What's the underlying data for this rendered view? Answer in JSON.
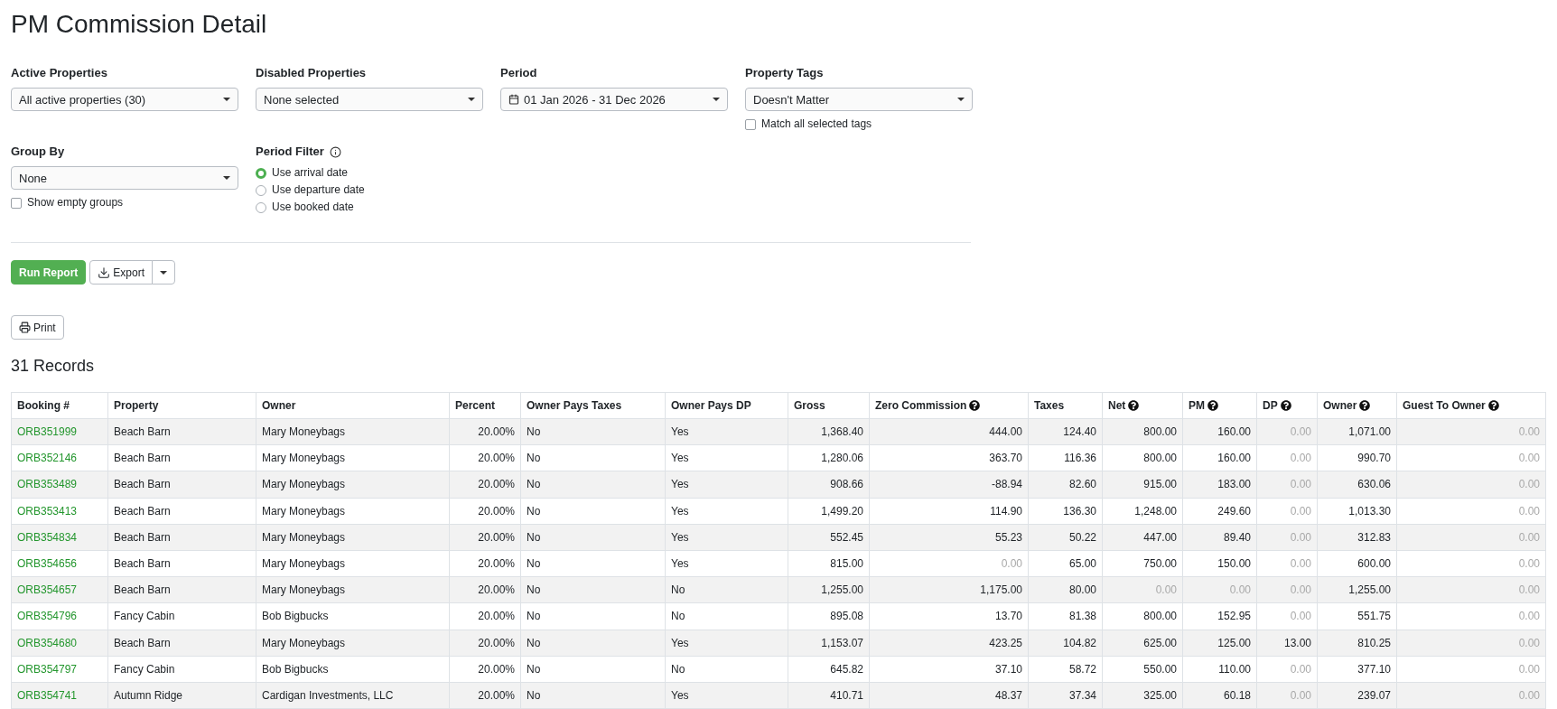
{
  "page": {
    "title": "PM Commission Detail"
  },
  "filters": [
    {
      "kind": "select",
      "label": "Active Properties",
      "value": "All active properties (30)"
    },
    {
      "kind": "select",
      "label": "Disabled Properties",
      "value": "None selected"
    },
    {
      "kind": "date_range",
      "label": "Period",
      "value": "01 Jan 2026 - 31 Dec 2026"
    },
    {
      "kind": "select",
      "label": "Property Tags",
      "value": "Doesn't Matter",
      "checkbox": {
        "label": "Match all selected tags",
        "checked": false
      }
    },
    {
      "kind": "select",
      "label": "Group By",
      "value": "None",
      "checkbox": {
        "label": "Show empty groups",
        "checked": false
      }
    },
    {
      "kind": "radio_group",
      "label": "Period Filter",
      "info_icon": true,
      "options": [
        {
          "label": "Use arrival date",
          "selected": true
        },
        {
          "label": "Use departure date",
          "selected": false
        },
        {
          "label": "Use booked date",
          "selected": false
        }
      ]
    }
  ],
  "actions": {
    "run": "Run Report",
    "export": "Export",
    "print": "Print"
  },
  "records_count": "31 Records",
  "table": {
    "columns": [
      {
        "label": "Booking #",
        "help": false
      },
      {
        "label": "Property",
        "help": false
      },
      {
        "label": "Owner",
        "help": false
      },
      {
        "label": "Percent",
        "help": false
      },
      {
        "label": "Owner Pays Taxes",
        "help": false
      },
      {
        "label": "Owner Pays DP",
        "help": false
      },
      {
        "label": "Gross",
        "help": false
      },
      {
        "label": "Zero Commission",
        "help": true
      },
      {
        "label": "Taxes",
        "help": false
      },
      {
        "label": "Net",
        "help": true
      },
      {
        "label": "PM",
        "help": true
      },
      {
        "label": "DP",
        "help": true
      },
      {
        "label": "Owner",
        "help": true
      },
      {
        "label": "Guest To Owner",
        "help": true
      }
    ],
    "rows": [
      {
        "booking": "ORB351999",
        "property": "Beach Barn",
        "owner": "Mary Moneybags",
        "percent": "20.00%",
        "owner_pays_taxes": "No",
        "owner_pays_dp": "Yes",
        "amounts": [
          {
            "text": "1,368.40",
            "muted": false
          },
          {
            "text": "444.00",
            "muted": false
          },
          {
            "text": "124.40",
            "muted": false
          },
          {
            "text": "800.00",
            "muted": false
          },
          {
            "text": "160.00",
            "muted": false
          },
          {
            "text": "0.00",
            "muted": true
          },
          {
            "text": "1,071.00",
            "muted": false
          },
          {
            "text": "0.00",
            "muted": true
          }
        ]
      },
      {
        "booking": "ORB352146",
        "property": "Beach Barn",
        "owner": "Mary Moneybags",
        "percent": "20.00%",
        "owner_pays_taxes": "No",
        "owner_pays_dp": "Yes",
        "amounts": [
          {
            "text": "1,280.06",
            "muted": false
          },
          {
            "text": "363.70",
            "muted": false
          },
          {
            "text": "116.36",
            "muted": false
          },
          {
            "text": "800.00",
            "muted": false
          },
          {
            "text": "160.00",
            "muted": false
          },
          {
            "text": "0.00",
            "muted": true
          },
          {
            "text": "990.70",
            "muted": false
          },
          {
            "text": "0.00",
            "muted": true
          }
        ]
      },
      {
        "booking": "ORB353489",
        "property": "Beach Barn",
        "owner": "Mary Moneybags",
        "percent": "20.00%",
        "owner_pays_taxes": "No",
        "owner_pays_dp": "Yes",
        "amounts": [
          {
            "text": "908.66",
            "muted": false
          },
          {
            "text": "-88.94",
            "muted": false
          },
          {
            "text": "82.60",
            "muted": false
          },
          {
            "text": "915.00",
            "muted": false
          },
          {
            "text": "183.00",
            "muted": false
          },
          {
            "text": "0.00",
            "muted": true
          },
          {
            "text": "630.06",
            "muted": false
          },
          {
            "text": "0.00",
            "muted": true
          }
        ]
      },
      {
        "booking": "ORB353413",
        "property": "Beach Barn",
        "owner": "Mary Moneybags",
        "percent": "20.00%",
        "owner_pays_taxes": "No",
        "owner_pays_dp": "Yes",
        "amounts": [
          {
            "text": "1,499.20",
            "muted": false
          },
          {
            "text": "114.90",
            "muted": false
          },
          {
            "text": "136.30",
            "muted": false
          },
          {
            "text": "1,248.00",
            "muted": false
          },
          {
            "text": "249.60",
            "muted": false
          },
          {
            "text": "0.00",
            "muted": true
          },
          {
            "text": "1,013.30",
            "muted": false
          },
          {
            "text": "0.00",
            "muted": true
          }
        ]
      },
      {
        "booking": "ORB354834",
        "property": "Beach Barn",
        "owner": "Mary Moneybags",
        "percent": "20.00%",
        "owner_pays_taxes": "No",
        "owner_pays_dp": "Yes",
        "amounts": [
          {
            "text": "552.45",
            "muted": false
          },
          {
            "text": "55.23",
            "muted": false
          },
          {
            "text": "50.22",
            "muted": false
          },
          {
            "text": "447.00",
            "muted": false
          },
          {
            "text": "89.40",
            "muted": false
          },
          {
            "text": "0.00",
            "muted": true
          },
          {
            "text": "312.83",
            "muted": false
          },
          {
            "text": "0.00",
            "muted": true
          }
        ]
      },
      {
        "booking": "ORB354656",
        "property": "Beach Barn",
        "owner": "Mary Moneybags",
        "percent": "20.00%",
        "owner_pays_taxes": "No",
        "owner_pays_dp": "Yes",
        "amounts": [
          {
            "text": "815.00",
            "muted": false
          },
          {
            "text": "0.00",
            "muted": true
          },
          {
            "text": "65.00",
            "muted": false
          },
          {
            "text": "750.00",
            "muted": false
          },
          {
            "text": "150.00",
            "muted": false
          },
          {
            "text": "0.00",
            "muted": true
          },
          {
            "text": "600.00",
            "muted": false
          },
          {
            "text": "0.00",
            "muted": true
          }
        ]
      },
      {
        "booking": "ORB354657",
        "property": "Beach Barn",
        "owner": "Mary Moneybags",
        "percent": "20.00%",
        "owner_pays_taxes": "No",
        "owner_pays_dp": "No",
        "amounts": [
          {
            "text": "1,255.00",
            "muted": false
          },
          {
            "text": "1,175.00",
            "muted": false
          },
          {
            "text": "80.00",
            "muted": false
          },
          {
            "text": "0.00",
            "muted": true
          },
          {
            "text": "0.00",
            "muted": true
          },
          {
            "text": "0.00",
            "muted": true
          },
          {
            "text": "1,255.00",
            "muted": false
          },
          {
            "text": "0.00",
            "muted": true
          }
        ]
      },
      {
        "booking": "ORB354796",
        "property": "Fancy Cabin",
        "owner": "Bob Bigbucks",
        "percent": "20.00%",
        "owner_pays_taxes": "No",
        "owner_pays_dp": "No",
        "amounts": [
          {
            "text": "895.08",
            "muted": false
          },
          {
            "text": "13.70",
            "muted": false
          },
          {
            "text": "81.38",
            "muted": false
          },
          {
            "text": "800.00",
            "muted": false
          },
          {
            "text": "152.95",
            "muted": false
          },
          {
            "text": "0.00",
            "muted": true
          },
          {
            "text": "551.75",
            "muted": false
          },
          {
            "text": "0.00",
            "muted": true
          }
        ]
      },
      {
        "booking": "ORB354680",
        "property": "Beach Barn",
        "owner": "Mary Moneybags",
        "percent": "20.00%",
        "owner_pays_taxes": "No",
        "owner_pays_dp": "Yes",
        "amounts": [
          {
            "text": "1,153.07",
            "muted": false
          },
          {
            "text": "423.25",
            "muted": false
          },
          {
            "text": "104.82",
            "muted": false
          },
          {
            "text": "625.00",
            "muted": false
          },
          {
            "text": "125.00",
            "muted": false
          },
          {
            "text": "13.00",
            "muted": false
          },
          {
            "text": "810.25",
            "muted": false
          },
          {
            "text": "0.00",
            "muted": true
          }
        ]
      },
      {
        "booking": "ORB354797",
        "property": "Fancy Cabin",
        "owner": "Bob Bigbucks",
        "percent": "20.00%",
        "owner_pays_taxes": "No",
        "owner_pays_dp": "No",
        "amounts": [
          {
            "text": "645.82",
            "muted": false
          },
          {
            "text": "37.10",
            "muted": false
          },
          {
            "text": "58.72",
            "muted": false
          },
          {
            "text": "550.00",
            "muted": false
          },
          {
            "text": "110.00",
            "muted": false
          },
          {
            "text": "0.00",
            "muted": true
          },
          {
            "text": "377.10",
            "muted": false
          },
          {
            "text": "0.00",
            "muted": true
          }
        ]
      },
      {
        "booking": "ORB354741",
        "property": "Autumn Ridge",
        "owner": "Cardigan Investments, LLC",
        "percent": "20.00%",
        "owner_pays_taxes": "No",
        "owner_pays_dp": "Yes",
        "amounts": [
          {
            "text": "410.71",
            "muted": false
          },
          {
            "text": "48.37",
            "muted": false
          },
          {
            "text": "37.34",
            "muted": false
          },
          {
            "text": "325.00",
            "muted": false
          },
          {
            "text": "60.18",
            "muted": false
          },
          {
            "text": "0.00",
            "muted": true
          },
          {
            "text": "239.07",
            "muted": false
          },
          {
            "text": "0.00",
            "muted": true
          }
        ]
      }
    ]
  }
}
